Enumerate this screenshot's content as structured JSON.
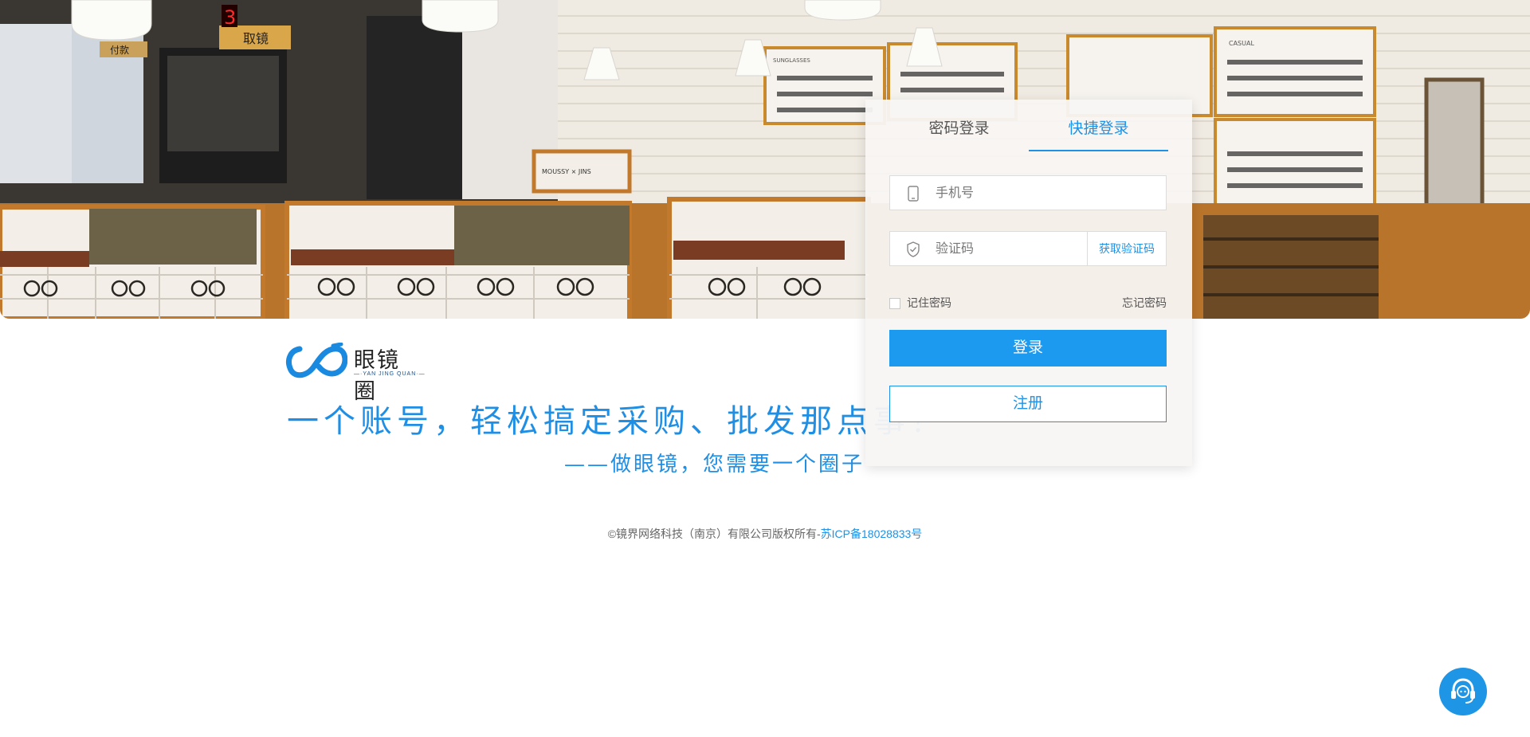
{
  "login": {
    "tabs": [
      "密码登录",
      "快捷登录"
    ],
    "active_tab": "快捷登录",
    "phone_placeholder": "手机号",
    "code_placeholder": "验证码",
    "get_code_label": "获取验证码",
    "remember_label": "记住密码",
    "forgot_label": "忘记密码",
    "login_button": "登录",
    "register_button": "注册"
  },
  "branding": {
    "logo_name": "眼镜圈",
    "logo_sub": "—·YAN JING QUAN·—",
    "slogan": "一个账号，轻松搞定采购、批发那点事！",
    "sub_slogan": "——做眼镜，您需要一个圈子"
  },
  "footer": {
    "copyright": "©镜界网络科技（南京）有限公司版权所有-",
    "icp": "苏ICP备18028833号"
  },
  "hero_signs": {
    "counter": "3",
    "pickup": "取镜",
    "billing": "付款",
    "casual": "CASUAL",
    "sunglasses": "SUNGLASSES",
    "moussy": "MOUSSY × JINS"
  },
  "colors": {
    "accent": "#1c93e8",
    "login_button": "#1c9af0",
    "support_button": "#1f95e6"
  },
  "icons": {
    "phone": "phone-icon",
    "shield": "shield-check-icon",
    "support": "headset-support-icon"
  }
}
